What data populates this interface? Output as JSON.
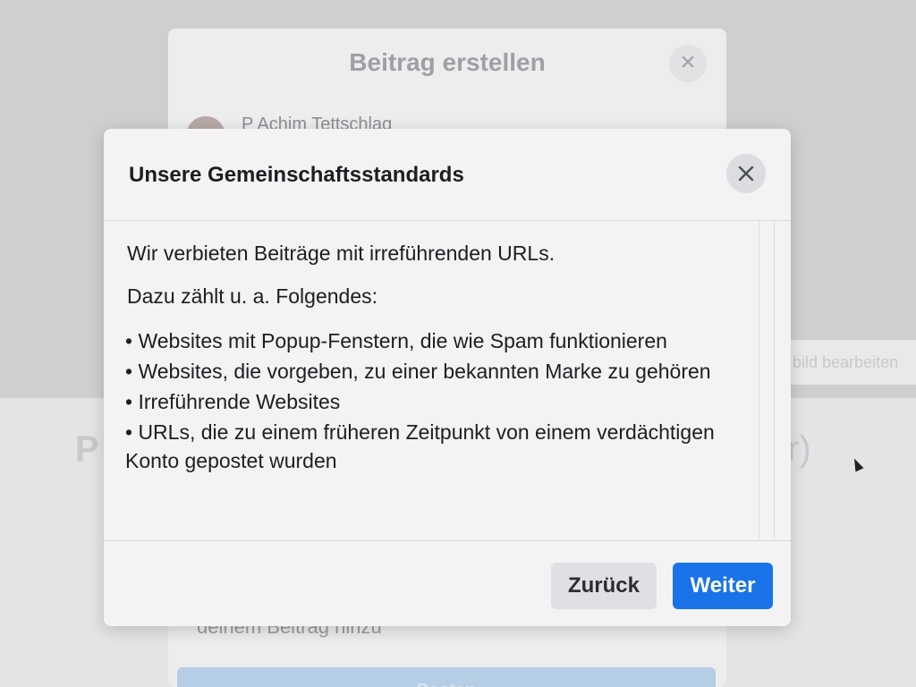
{
  "background": {
    "right_panel_text": "bild bearbeiten",
    "big_letter": "P",
    "big_paren": "r)"
  },
  "post_dialog": {
    "title": "Beitrag erstellen",
    "user_name": "P Achim Tettschlag",
    "add_text": "deinem Beitrag hinzu",
    "post_button_label": "Posten"
  },
  "modal": {
    "title": "Unsere Gemeinschaftsstandards",
    "intro": "Wir verbieten Beiträge mit irreführenden URLs.",
    "lead": "Dazu zählt u. a. Folgendes:",
    "bullets": [
      "• Websites mit Popup-Fenstern, die wie Spam funktionieren",
      "• Websites, die vorgeben, zu einer bekannten Marke zu gehören",
      "• Irreführende Websites",
      "• URLs, die zu einem früheren Zeitpunkt von einem verdächtigen Konto gepostet wurden"
    ],
    "back_label": "Zurück",
    "next_label": "Weiter"
  },
  "colors": {
    "primary": "#1a73e8",
    "modal_bg": "#f3f3f4",
    "text": "#1c1e21"
  }
}
